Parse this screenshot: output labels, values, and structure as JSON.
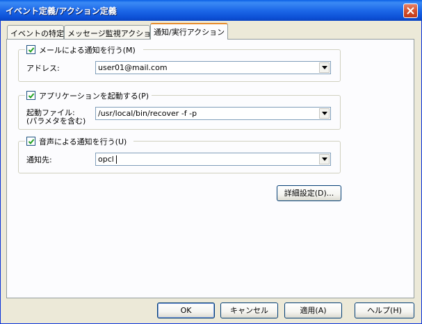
{
  "window": {
    "title": "イベント定義/アクション定義"
  },
  "tabs": [
    {
      "label": "イベントの特定"
    },
    {
      "label": "メッセージ監視アクション"
    },
    {
      "label": "通知/実行アクション"
    }
  ],
  "mail_group": {
    "checkbox_label": "メールによる通知を行う(M)",
    "checked": true,
    "field_label": "アドレス:",
    "value": "user01@mail.com"
  },
  "app_group": {
    "checkbox_label": "アプリケーションを起動する(P)",
    "checked": true,
    "field_label_line1": "起動ファイル:",
    "field_label_line2": "(パラメタを含む)",
    "value": "/usr/local/bin/recover -f -p"
  },
  "voice_group": {
    "checkbox_label": "音声による通知を行う(U)",
    "checked": true,
    "field_label": "通知先:",
    "value": "opcl"
  },
  "detail_button": "詳細設定(D)...",
  "footer": {
    "ok": "OK",
    "cancel": "キャンセル",
    "apply": "適用(A)",
    "help": "ヘルプ(H)"
  }
}
